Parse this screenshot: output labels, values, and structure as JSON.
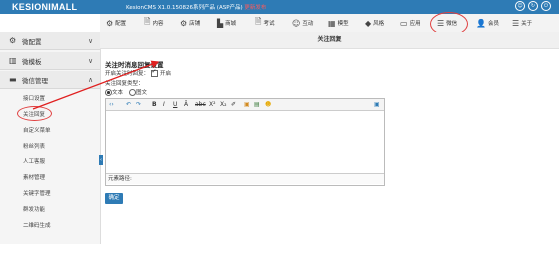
{
  "app": {
    "logo": "KESIONIMALL",
    "version_prefix": "KesionCMS X1.0.150826系列产品 (ASP产品) ",
    "version_link": "更新发布",
    "top_icons": [
      "circle-icon-1",
      "circle-icon-2",
      "circle-icon-3"
    ]
  },
  "nav": {
    "items": [
      {
        "label": "配置",
        "icon": "gear-icon"
      },
      {
        "label": "内容",
        "icon": "document-icon"
      },
      {
        "label": "店铺",
        "icon": "gear-icon"
      },
      {
        "label": "商城",
        "icon": "shop-icon"
      },
      {
        "label": "考试",
        "icon": "document-icon"
      },
      {
        "label": "互动",
        "icon": "people-icon"
      },
      {
        "label": "模型",
        "icon": "grid-icon"
      },
      {
        "label": "风格",
        "icon": "tag-icon"
      },
      {
        "label": "应用",
        "icon": "monitor-icon"
      },
      {
        "label": "微信",
        "icon": "menu-icon"
      },
      {
        "label": "会员",
        "icon": "user-icon"
      },
      {
        "label": "关于",
        "icon": "menu-icon"
      }
    ]
  },
  "sidebar": {
    "sections": [
      {
        "label": "微配置",
        "icon": "gear-icon",
        "chevron": "∨"
      },
      {
        "label": "微模板",
        "icon": "template-icon",
        "chevron": "∨"
      },
      {
        "label": "微信管理",
        "icon": "chat-icon",
        "chevron": "∧"
      }
    ],
    "items": [
      "接口设置",
      "关注回复",
      "自定义菜单",
      "粉丝列表",
      "人工客服",
      "素材管理",
      "关键字管理",
      "群发功能",
      "二维码生成"
    ]
  },
  "main": {
    "title": "关注回复",
    "section_title": "关注时消息回复设置",
    "enable_label": "开启关注时回复：",
    "enable_option": "开启",
    "type_label": "关注回复类型：",
    "type_options": [
      "文本",
      "图文"
    ],
    "path_label": "元素路径:",
    "ok_label": "确定"
  }
}
